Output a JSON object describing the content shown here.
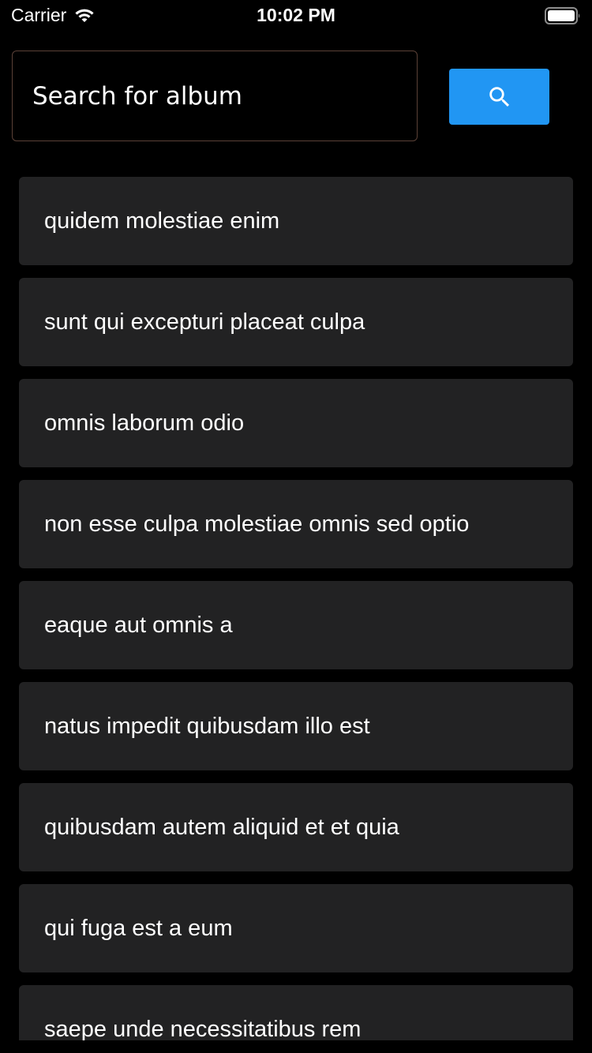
{
  "status_bar": {
    "carrier": "Carrier",
    "time": "10:02 PM"
  },
  "search": {
    "placeholder": "Search for album",
    "value": "",
    "button_icon": "search-icon"
  },
  "albums": [
    {
      "title": "quidem molestiae enim"
    },
    {
      "title": "sunt qui excepturi placeat culpa"
    },
    {
      "title": "omnis laborum odio"
    },
    {
      "title": "non esse culpa molestiae omnis sed optio"
    },
    {
      "title": "eaque aut omnis a"
    },
    {
      "title": "natus impedit quibusdam illo est"
    },
    {
      "title": "quibusdam autem aliquid et et quia"
    },
    {
      "title": "qui fuga est a eum"
    },
    {
      "title": "saepe unde necessitatibus rem"
    }
  ],
  "colors": {
    "background": "#000000",
    "card": "#222223",
    "accent": "#2196f3",
    "search_border": "#5b4137",
    "text": "#ffffff"
  }
}
